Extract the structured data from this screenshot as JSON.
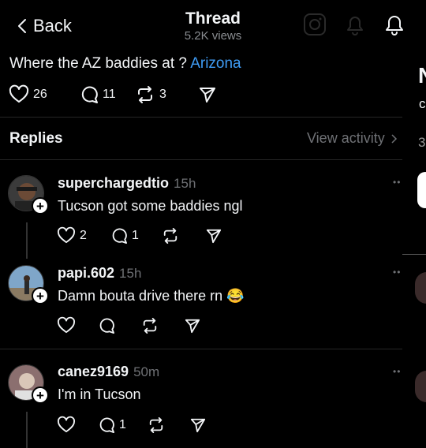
{
  "header": {
    "back_label": "Back",
    "title": "Thread",
    "views": "5.2K views",
    "icons": [
      "instagram-icon",
      "notification-bell-icon",
      "bell-icon"
    ]
  },
  "post": {
    "text": "Where the AZ baddies at ?",
    "tag": "Arizona",
    "likes": "26",
    "replies": "11",
    "reposts": "3"
  },
  "replies_section": {
    "label": "Replies",
    "activity_label": "View activity"
  },
  "replies": [
    {
      "username": "superchargedtio",
      "time": "15h",
      "text": "Tucson got some baddies ngl",
      "likes": "2",
      "replies": "1"
    },
    {
      "username": "papi.602",
      "time": "15h",
      "text": "Damn bouta drive there rn 😂",
      "likes": "",
      "replies": ""
    },
    {
      "username": "canez9169",
      "time": "50m",
      "text": "I'm in Tucson",
      "likes": "",
      "replies": "1"
    }
  ],
  "edge": {
    "n": "N",
    "c": "c",
    "three": "3"
  },
  "plus_symbol": "+",
  "more_symbol": "••",
  "colors": {
    "background": "#000000",
    "text": "#f3f5f7",
    "link": "#3f9cf5",
    "muted": "#6f7175"
  }
}
